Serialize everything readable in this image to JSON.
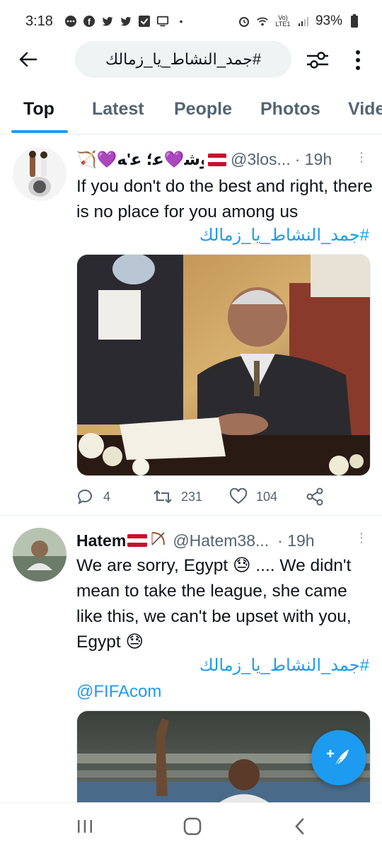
{
  "status_bar": {
    "time": "3:18",
    "network": "Vo) LTE1",
    "battery": "93%"
  },
  "search": {
    "query": "#جمد_النشاط_يا_زمالك"
  },
  "tabs": [
    {
      "label": "Top"
    },
    {
      "label": "Latest"
    },
    {
      "label": "People"
    },
    {
      "label": "Photos"
    },
    {
      "label": "Vide"
    }
  ],
  "tweets": [
    {
      "name": "🏹💜ﻋﻞﻮﺷ💜ﻋ؛ ﻋ'ﻪ",
      "handle": "@3los...",
      "time": "· 19h",
      "text": "If you don't do the best and right, there is no place for you among us",
      "hashtag": "#جمد_النشاط_يا_زمالك",
      "replies": "4",
      "retweets": "231",
      "likes": "104"
    },
    {
      "name": "Hatem",
      "handle": "@Hatem38...",
      "time": "· 19h",
      "text": "We are sorry, Egypt 😓 .... We didn't mean to take the league, she came like this, we can't be upset with you, Egypt 😓",
      "hashtag": "#جمد_النشاط_يا_زمالك",
      "mention": "@FIFAcom"
    }
  ],
  "colors": {
    "accent": "#1d9bf0",
    "secondary_text": "#536471",
    "primary_text": "#0f1419"
  }
}
